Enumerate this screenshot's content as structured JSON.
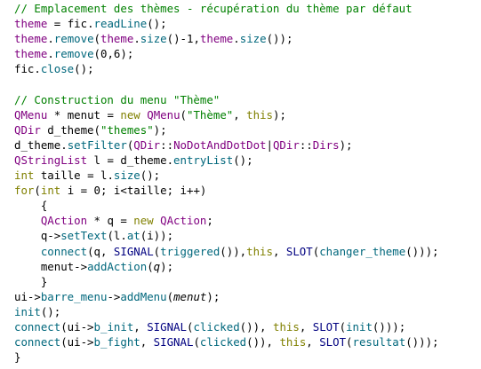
{
  "editor": {
    "colors": {
      "background": "#ffffff",
      "plain": "#000000",
      "comment": "#008000",
      "keyword": "#808000",
      "type": "#800080",
      "method": "#00677c",
      "string": "#008000",
      "number": "#000080",
      "macro": "#000080"
    },
    "lines": [
      [
        [
          "comment",
          "// Emplacement des thèmes - récupération du thème par défaut"
        ]
      ],
      [
        [
          "type",
          "theme"
        ],
        [
          "plain",
          " = fic."
        ],
        [
          "method",
          "readLine"
        ],
        [
          "plain",
          "();"
        ]
      ],
      [
        [
          "type",
          "theme"
        ],
        [
          "plain",
          "."
        ],
        [
          "method",
          "remove"
        ],
        [
          "plain",
          "("
        ],
        [
          "type",
          "theme"
        ],
        [
          "plain",
          "."
        ],
        [
          "method",
          "size"
        ],
        [
          "plain",
          "()-1,"
        ],
        [
          "type",
          "theme"
        ],
        [
          "plain",
          "."
        ],
        [
          "method",
          "size"
        ],
        [
          "plain",
          "());"
        ]
      ],
      [
        [
          "type",
          "theme"
        ],
        [
          "plain",
          "."
        ],
        [
          "method",
          "remove"
        ],
        [
          "plain",
          "(0,6);"
        ]
      ],
      [
        [
          "plain",
          "fic."
        ],
        [
          "method",
          "close"
        ],
        [
          "plain",
          "();"
        ]
      ],
      [],
      [
        [
          "comment",
          "// Construction du menu \"Thème\""
        ]
      ],
      [
        [
          "type",
          "QMenu"
        ],
        [
          "plain",
          " * menut = "
        ],
        [
          "keyword",
          "new"
        ],
        [
          "plain",
          " "
        ],
        [
          "type",
          "QMenu"
        ],
        [
          "plain",
          "("
        ],
        [
          "string",
          "\"Thème\""
        ],
        [
          "plain",
          ", "
        ],
        [
          "keyword",
          "this"
        ],
        [
          "plain",
          ");"
        ]
      ],
      [
        [
          "type",
          "QDir"
        ],
        [
          "plain",
          " d_theme("
        ],
        [
          "string",
          "\"themes\""
        ],
        [
          "plain",
          ");"
        ]
      ],
      [
        [
          "plain",
          "d_theme."
        ],
        [
          "method",
          "setFilter"
        ],
        [
          "plain",
          "("
        ],
        [
          "type",
          "QDir"
        ],
        [
          "plain",
          "::"
        ],
        [
          "type",
          "NoDotAndDotDot"
        ],
        [
          "plain",
          "|"
        ],
        [
          "type",
          "QDir"
        ],
        [
          "plain",
          "::"
        ],
        [
          "type",
          "Dirs"
        ],
        [
          "plain",
          ");"
        ]
      ],
      [
        [
          "type",
          "QStringList"
        ],
        [
          "plain",
          " l = d_theme."
        ],
        [
          "method",
          "entryList"
        ],
        [
          "plain",
          "();"
        ]
      ],
      [
        [
          "keyword",
          "int"
        ],
        [
          "plain",
          " taille = l."
        ],
        [
          "method",
          "size"
        ],
        [
          "plain",
          "();"
        ]
      ],
      [
        [
          "keyword",
          "for"
        ],
        [
          "plain",
          "("
        ],
        [
          "keyword",
          "int"
        ],
        [
          "plain",
          " i = 0; i<taille; i++)"
        ]
      ],
      [
        [
          "plain",
          "    {"
        ]
      ],
      [
        [
          "plain",
          "    "
        ],
        [
          "type",
          "QAction"
        ],
        [
          "plain",
          " * q = "
        ],
        [
          "keyword",
          "new"
        ],
        [
          "plain",
          " "
        ],
        [
          "type",
          "QAction"
        ],
        [
          "plain",
          ";"
        ]
      ],
      [
        [
          "plain",
          "    q->"
        ],
        [
          "method",
          "setText"
        ],
        [
          "plain",
          "(l."
        ],
        [
          "method",
          "at"
        ],
        [
          "plain",
          "(i));"
        ]
      ],
      [
        [
          "plain",
          "    "
        ],
        [
          "method",
          "connect"
        ],
        [
          "plain",
          "(q, "
        ],
        [
          "macro",
          "SIGNAL"
        ],
        [
          "plain",
          "("
        ],
        [
          "method",
          "triggered"
        ],
        [
          "plain",
          "()),"
        ],
        [
          "keyword",
          "this"
        ],
        [
          "plain",
          ", "
        ],
        [
          "macro",
          "SLOT"
        ],
        [
          "plain",
          "("
        ],
        [
          "method",
          "changer_theme"
        ],
        [
          "plain",
          "()));"
        ]
      ],
      [
        [
          "plain",
          "    menut->"
        ],
        [
          "method",
          "addAction"
        ],
        [
          "plain",
          "("
        ],
        [
          "italic",
          "q"
        ],
        [
          "plain",
          ");"
        ]
      ],
      [
        [
          "plain",
          "    }"
        ]
      ],
      [
        [
          "plain",
          "ui->"
        ],
        [
          "method",
          "barre_menu"
        ],
        [
          "plain",
          "->"
        ],
        [
          "method",
          "addMenu"
        ],
        [
          "plain",
          "("
        ],
        [
          "italic",
          "menut"
        ],
        [
          "plain",
          ");"
        ]
      ],
      [
        [
          "method",
          "init"
        ],
        [
          "plain",
          "();"
        ]
      ],
      [
        [
          "method",
          "connect"
        ],
        [
          "plain",
          "(ui->"
        ],
        [
          "method",
          "b_init"
        ],
        [
          "plain",
          ", "
        ],
        [
          "macro",
          "SIGNAL"
        ],
        [
          "plain",
          "("
        ],
        [
          "method",
          "clicked"
        ],
        [
          "plain",
          "()), "
        ],
        [
          "keyword",
          "this"
        ],
        [
          "plain",
          ", "
        ],
        [
          "macro",
          "SLOT"
        ],
        [
          "plain",
          "("
        ],
        [
          "method",
          "init"
        ],
        [
          "plain",
          "()));"
        ]
      ],
      [
        [
          "method",
          "connect"
        ],
        [
          "plain",
          "(ui->"
        ],
        [
          "method",
          "b_fight"
        ],
        [
          "plain",
          ", "
        ],
        [
          "macro",
          "SIGNAL"
        ],
        [
          "plain",
          "("
        ],
        [
          "method",
          "clicked"
        ],
        [
          "plain",
          "()), "
        ],
        [
          "keyword",
          "this"
        ],
        [
          "plain",
          ", "
        ],
        [
          "macro",
          "SLOT"
        ],
        [
          "plain",
          "("
        ],
        [
          "method",
          "resultat"
        ],
        [
          "plain",
          "()));"
        ]
      ],
      [
        [
          "plain",
          "}"
        ]
      ]
    ]
  }
}
